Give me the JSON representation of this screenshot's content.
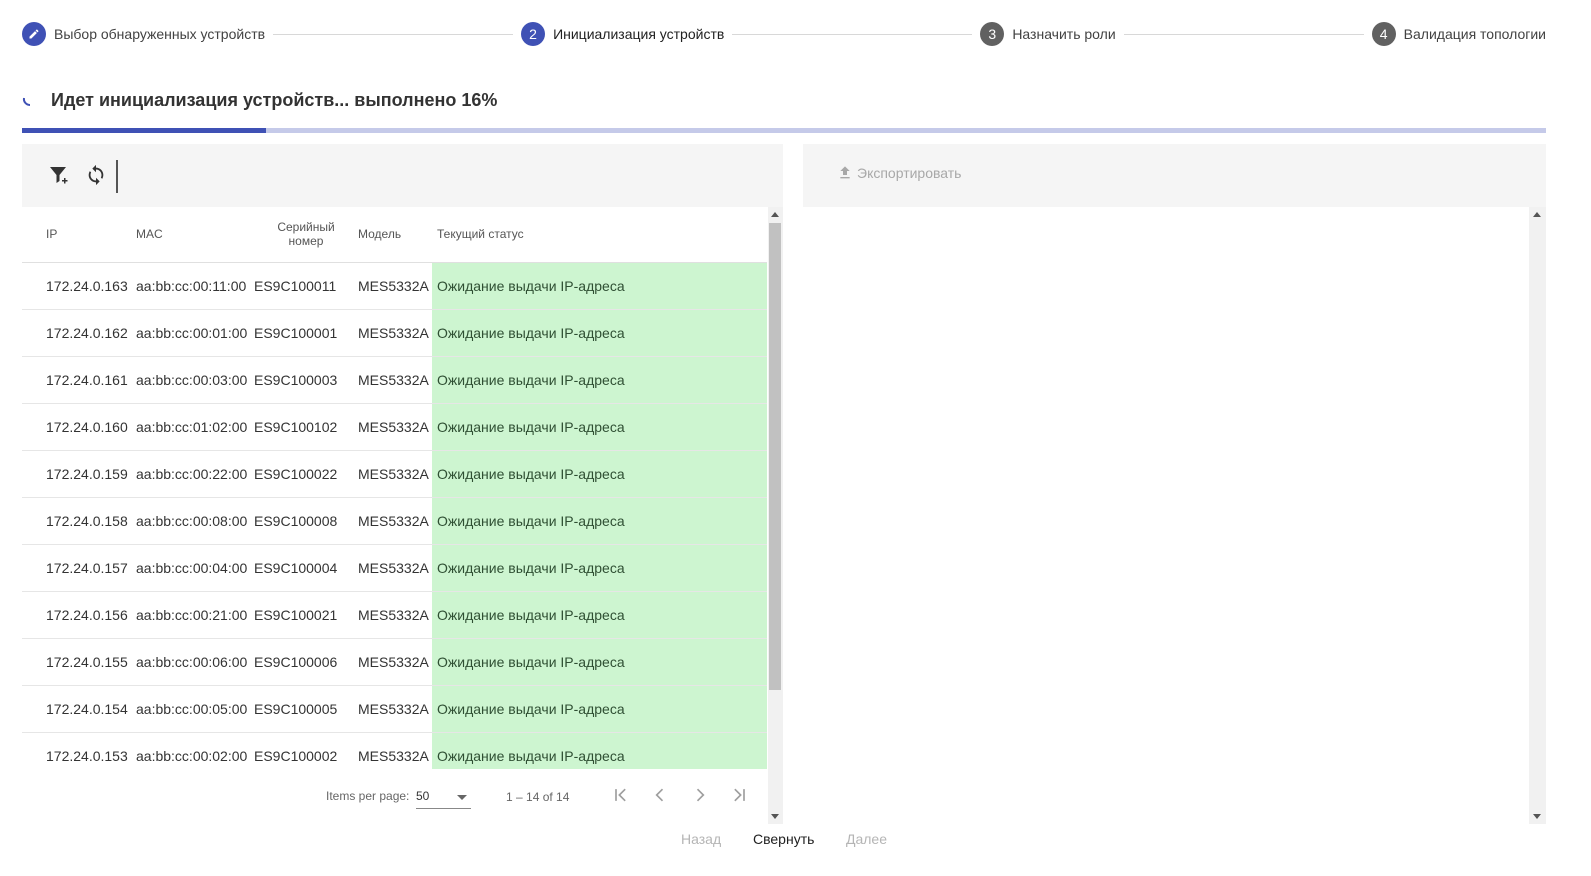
{
  "stepper": {
    "steps": [
      {
        "number": "",
        "label": "Выбор обнаруженных устройств",
        "state": "done"
      },
      {
        "number": "2",
        "label": "Инициализация устройств",
        "state": "active"
      },
      {
        "number": "3",
        "label": "Назначить роли",
        "state": "pending"
      },
      {
        "number": "4",
        "label": "Валидация топологии",
        "state": "pending"
      }
    ]
  },
  "progress": {
    "title": "Идет инициализация устройств... выполнено 16%",
    "percent": 16
  },
  "toolbar": {
    "filter_icon": "filter-add-icon",
    "refresh_icon": "refresh-icon"
  },
  "table": {
    "headers": {
      "ip": "IP",
      "mac": "MAC",
      "serial": "Серийный номер",
      "model": "Модель",
      "status": "Текущий статус"
    },
    "rows": [
      {
        "ip": "172.24.0.163",
        "mac": "aa:bb:cc:00:11:00",
        "serial": "ES9C100011",
        "model": "MES5332A",
        "status": "Ожидание выдачи IP-адреса"
      },
      {
        "ip": "172.24.0.162",
        "mac": "aa:bb:cc:00:01:00",
        "serial": "ES9C100001",
        "model": "MES5332A",
        "status": "Ожидание выдачи IP-адреса"
      },
      {
        "ip": "172.24.0.161",
        "mac": "aa:bb:cc:00:03:00",
        "serial": "ES9C100003",
        "model": "MES5332A",
        "status": "Ожидание выдачи IP-адреса"
      },
      {
        "ip": "172.24.0.160",
        "mac": "aa:bb:cc:01:02:00",
        "serial": "ES9C100102",
        "model": "MES5332A",
        "status": "Ожидание выдачи IP-адреса"
      },
      {
        "ip": "172.24.0.159",
        "mac": "aa:bb:cc:00:22:00",
        "serial": "ES9C100022",
        "model": "MES5332A",
        "status": "Ожидание выдачи IP-адреса"
      },
      {
        "ip": "172.24.0.158",
        "mac": "aa:bb:cc:00:08:00",
        "serial": "ES9C100008",
        "model": "MES5332A",
        "status": "Ожидание выдачи IP-адреса"
      },
      {
        "ip": "172.24.0.157",
        "mac": "aa:bb:cc:00:04:00",
        "serial": "ES9C100004",
        "model": "MES5332A",
        "status": "Ожидание выдачи IP-адреса"
      },
      {
        "ip": "172.24.0.156",
        "mac": "aa:bb:cc:00:21:00",
        "serial": "ES9C100021",
        "model": "MES5332A",
        "status": "Ожидание выдачи IP-адреса"
      },
      {
        "ip": "172.24.0.155",
        "mac": "aa:bb:cc:00:06:00",
        "serial": "ES9C100006",
        "model": "MES5332A",
        "status": "Ожидание выдачи IP-адреса"
      },
      {
        "ip": "172.24.0.154",
        "mac": "aa:bb:cc:00:05:00",
        "serial": "ES9C100005",
        "model": "MES5332A",
        "status": "Ожидание выдачи IP-адреса"
      },
      {
        "ip": "172.24.0.153",
        "mac": "aa:bb:cc:00:02:00",
        "serial": "ES9C100002",
        "model": "MES5332A",
        "status": "Ожидание выдачи IP-адреса"
      }
    ]
  },
  "paginator": {
    "items_per_page_label": "Items per page:",
    "page_size": "50",
    "range": "1 – 14 of 14"
  },
  "export": {
    "label": "Экспортировать"
  },
  "nav": {
    "back": "Назад",
    "collapse": "Свернуть",
    "next": "Далее"
  },
  "colors": {
    "accent": "#3f51b5",
    "progress_track": "#c5cae9",
    "status_bg": "#cdf5d0"
  }
}
